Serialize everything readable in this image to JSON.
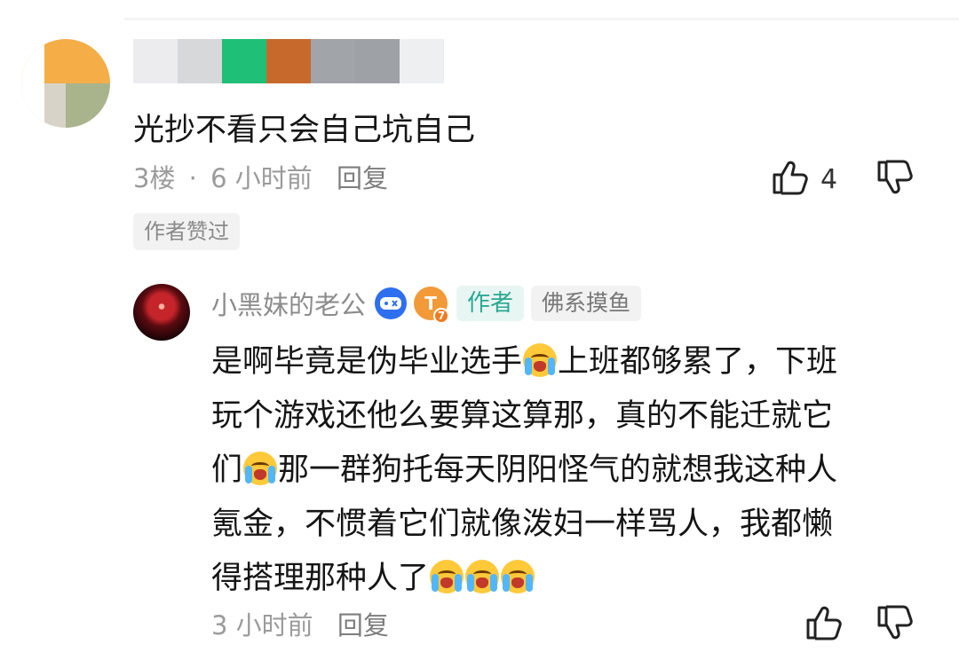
{
  "comment": {
    "floor": "3楼",
    "sep": "·",
    "time": "6 小时前",
    "reply_label": "回复",
    "text": "光抄不看只会自己坑自己",
    "like_count": "4",
    "author_liked_tag": "作者赞过"
  },
  "reply": {
    "username": "小黑妹的老公",
    "level_badge": "T",
    "level_number": "7",
    "author_tag": "作者",
    "title_tag": "佛系摸鱼",
    "lines": [
      {
        "before": "是啊毕竟是伪毕业选手",
        "after": "上班都够累了，下班"
      },
      {
        "before": "玩个游戏还他么要算这算那，真的不能迁就它",
        "after": ""
      },
      {
        "before": "们",
        "after": "那一群狗托每天阴阳怪气的就想我这种人"
      },
      {
        "before": "氪金，不惯着它们就像泼妇一样骂人，我都懒",
        "after": ""
      },
      {
        "before": "得搭理那种人了",
        "after": ""
      }
    ],
    "time": "3 小时前",
    "reply_label": "回复"
  },
  "icons": {
    "like": "thumbs-up-icon",
    "dislike": "thumbs-down-icon",
    "emoji": "loudly-crying-face-emoji",
    "game_badge": "game-controller-icon"
  },
  "colors": {
    "text": "#151515",
    "meta": "#9b9b9b",
    "author_tag_bg": "#e8f6f3",
    "author_tag_fg": "#2ba892",
    "level_badge": "#f29a38",
    "game_badge": "#2e6ff0"
  }
}
